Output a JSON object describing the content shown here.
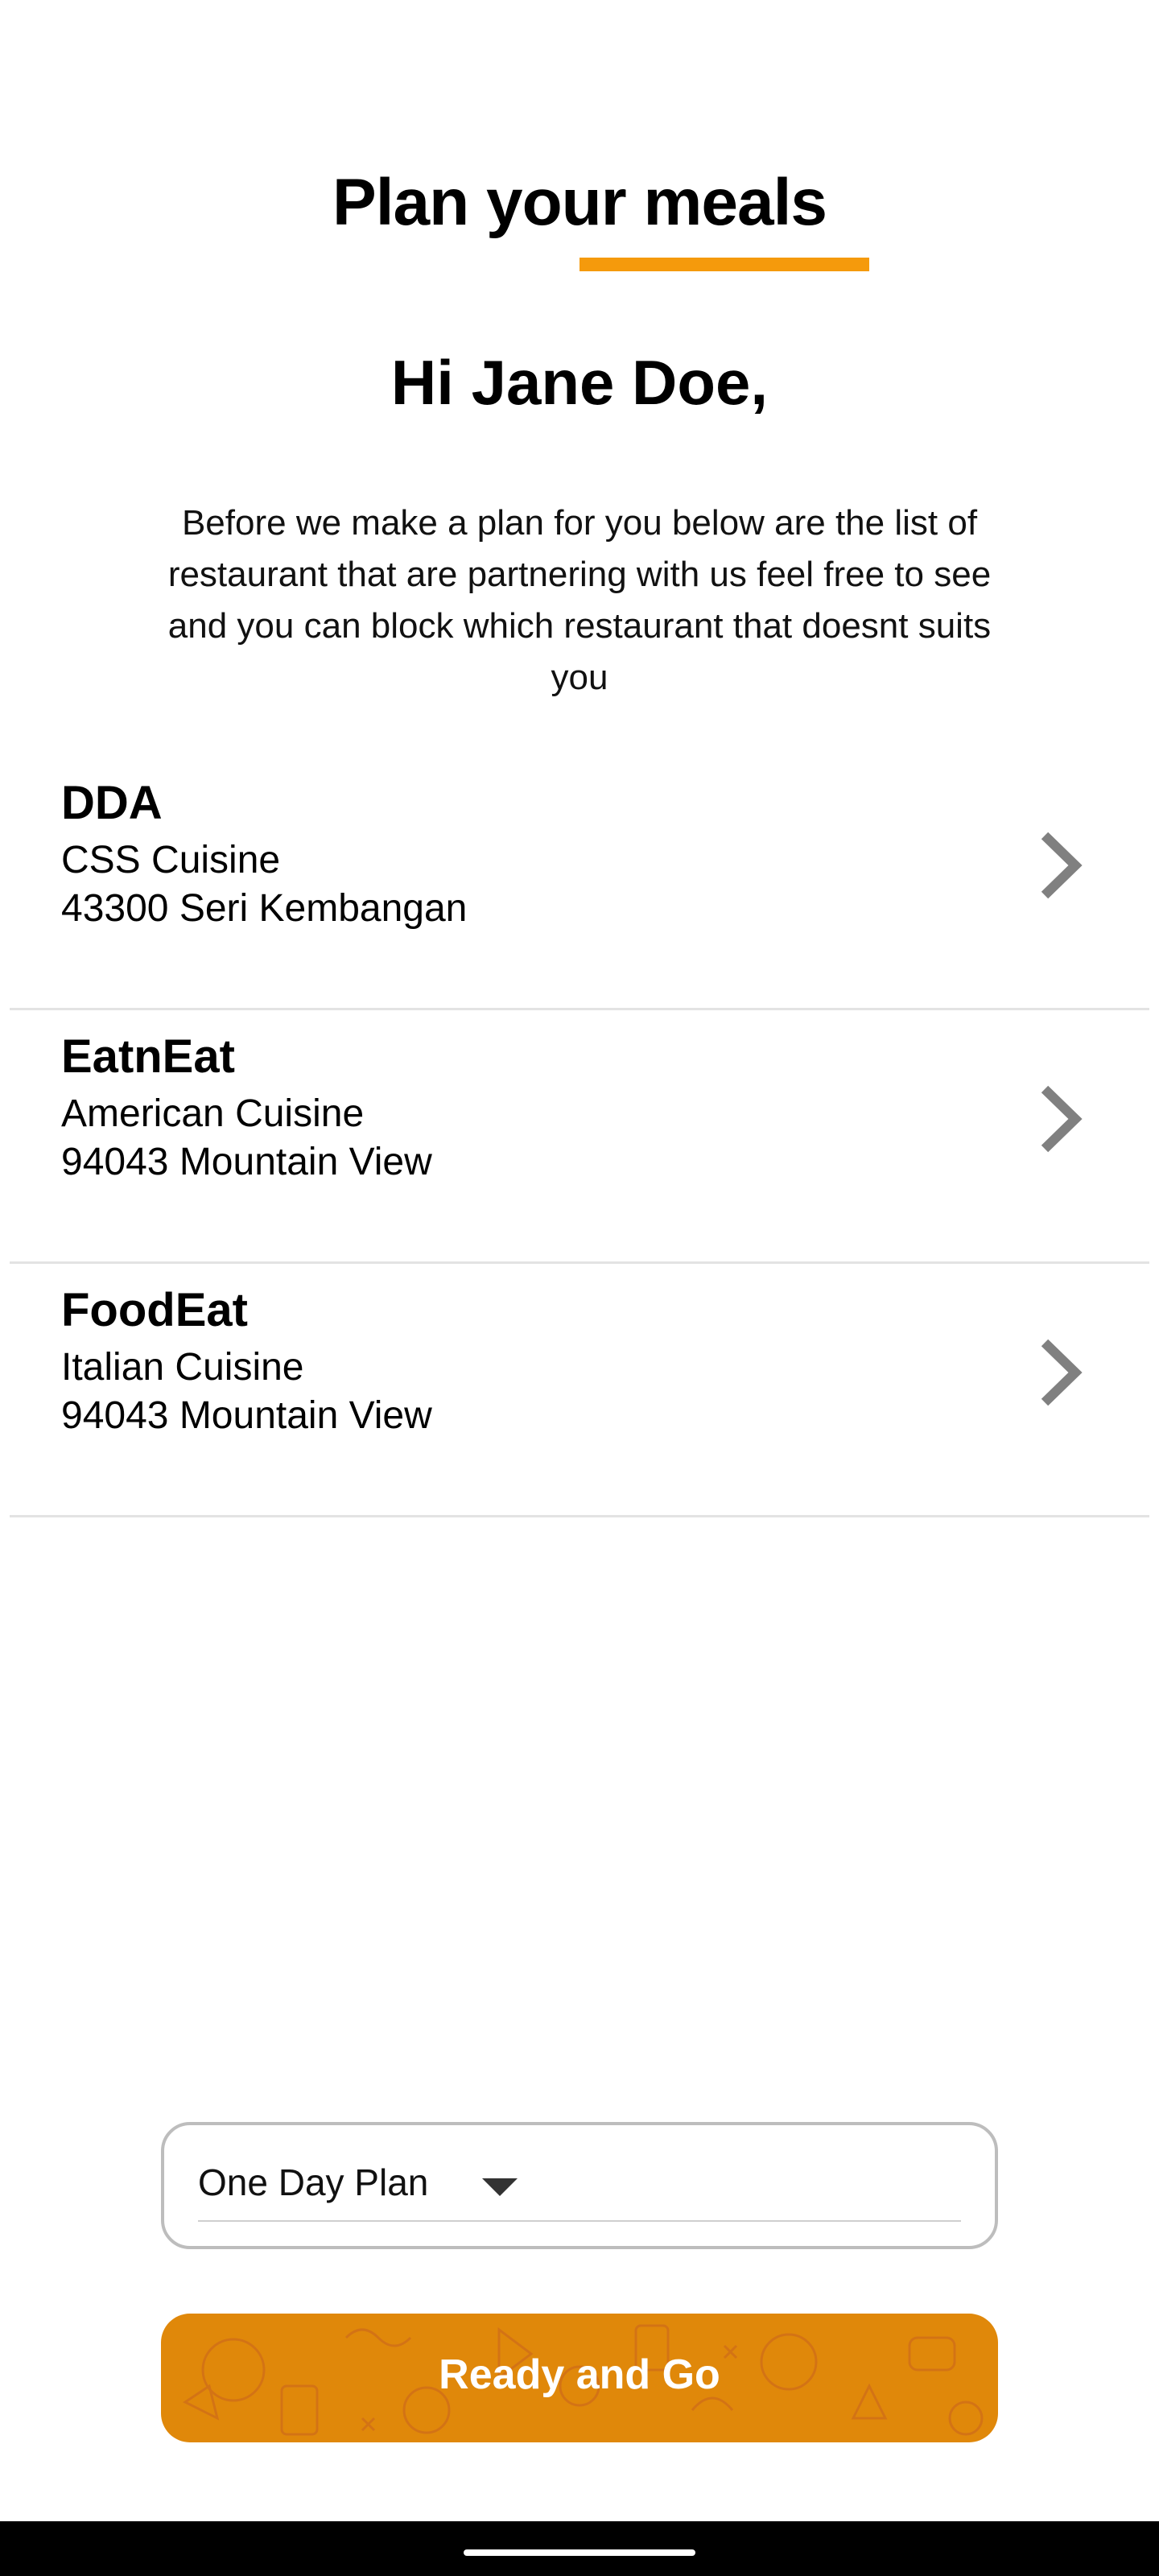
{
  "header": {
    "title": "Plan your meals",
    "accent_color": "#f59a0c"
  },
  "greeting": "Hi Jane Doe,",
  "intro_text": "Before we make a plan for you below are the list of restaurant that are partnering with us feel free to see and you can block which restaurant that doesnt suits you",
  "restaurants": [
    {
      "name": "DDA",
      "cuisine": "CSS Cuisine",
      "address": "43300 Seri Kembangan",
      "icon": "chevron-right-icon"
    },
    {
      "name": "EatnEat",
      "cuisine": "American Cuisine",
      "address": "94043 Mountain View",
      "icon": "chevron-right-icon"
    },
    {
      "name": "FoodEat",
      "cuisine": "Italian Cuisine",
      "address": "94043 Mountain View",
      "icon": "chevron-right-icon"
    }
  ],
  "plan_select": {
    "value": "One Day Plan",
    "icon": "caret-down-icon"
  },
  "go_button": {
    "label": "Ready and Go",
    "color": "#e0880a"
  }
}
